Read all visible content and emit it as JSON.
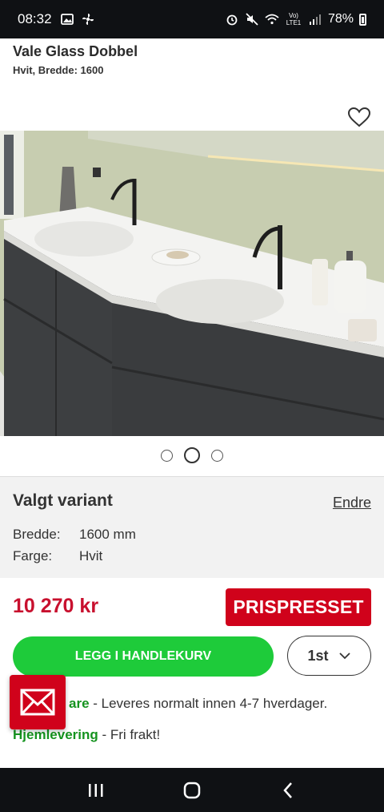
{
  "status_bar": {
    "time": "08:32",
    "network_label": "Vo) LTE1",
    "battery": "78%",
    "icons": [
      "image-icon",
      "fan-icon",
      "alarm-icon",
      "mute-icon",
      "wifi-icon",
      "signal-icon",
      "battery-icon"
    ]
  },
  "product": {
    "title": "Vale Glass Dobbel",
    "subtitle": "Hvit, Bredde: 1600"
  },
  "carousel": {
    "count": 3,
    "active_index": 1
  },
  "variant": {
    "heading": "Valgt variant",
    "change_label": "Endre",
    "rows": [
      {
        "key": "Bredde:",
        "value": "1600 mm"
      },
      {
        "key": "Farge:",
        "value": "Hvit"
      }
    ]
  },
  "pricing": {
    "price": "10 270 kr",
    "badge": "PRISPRESSET"
  },
  "actions": {
    "add_to_cart": "LEGG I HANDLEKURV",
    "quantity": "1st"
  },
  "delivery": {
    "line1_label": "are",
    "line1_text": " - Leveres normalt innen 4-7 hverdager.",
    "line2_label": "Hjemlevering",
    "line2_text": " - Fri frakt!"
  },
  "colors": {
    "price_red": "#c8102e",
    "badge_red": "#d0021b",
    "cta_green": "#1ecb3a",
    "delivery_green": "#15931f"
  }
}
